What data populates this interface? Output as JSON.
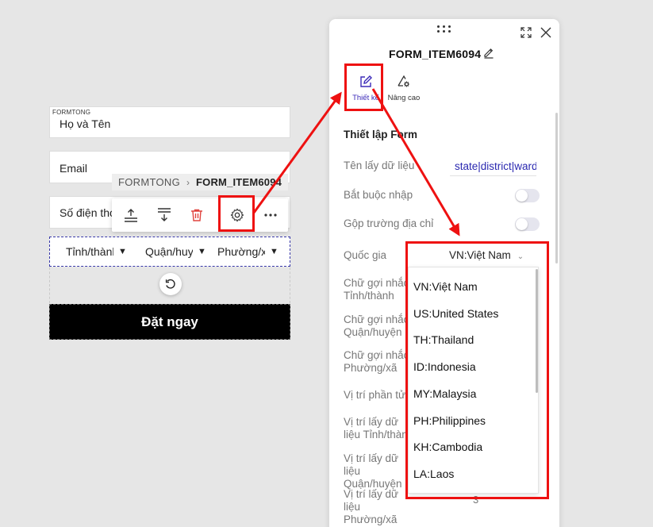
{
  "form": {
    "tag": "FORMTONG",
    "name_field": "Họ và Tên",
    "email_field": "Email",
    "phone_field": "Số điện thoại",
    "province_select": "Tỉnh/thành",
    "district_select": "Quận/huyện",
    "ward_select": "Phường/xã",
    "submit_label": "Đặt ngay"
  },
  "breadcrumb": {
    "root": "FORMTONG",
    "separator": "›",
    "current": "FORM_ITEM6094"
  },
  "toolbar": {
    "icons": [
      "move-up-icon",
      "move-down-icon",
      "trash-icon",
      "gear-icon",
      "more-icon"
    ]
  },
  "panel": {
    "title": "FORM_ITEM6094",
    "tabs": [
      {
        "label": "Thiết kế",
        "icon": "edit-icon",
        "active": true
      },
      {
        "label": "Nâng cao",
        "icon": "advanced-settings-icon",
        "active": false
      }
    ],
    "section_title": "Thiết lập Form",
    "field_name_label": "Tên lấy dữ liệu",
    "field_name_value": "state|district|ward",
    "required_label": "Bắt buộc nhập",
    "required_on": false,
    "merge_address_label": "Gộp trường địa chỉ",
    "merge_address_on": false,
    "country_label": "Quốc gia",
    "country_value": "VN:Việt Nam",
    "hint_province_label": "Chữ gợi nhắc Tỉnh/thành",
    "hint_district_label": "Chữ gợi nhắc Quận/huyện",
    "hint_ward_label": "Chữ gợi nhắc Phường/xã",
    "element_position_label": "Vị trí phần tử",
    "data_pos_province_label": "Vị trí lấy dữ liệu Tỉnh/thành",
    "data_pos_district_label": "Vị trí lấy dữ liệu Quận/huyện",
    "data_pos_ward_label": "Vị trí lấy dữ liệu Phường/xã",
    "data_pos_ward_value": "3"
  },
  "country_options": [
    "VN:Việt Nam",
    "US:United States",
    "TH:Thailand",
    "ID:Indonesia",
    "MY:Malaysia",
    "PH:Philippines",
    "KH:Cambodia",
    "LA:Laos"
  ],
  "colors": {
    "accent": "#3b2ab8",
    "highlight": "#e11111",
    "delete": "#e0443e",
    "submit_bg": "#000000"
  }
}
